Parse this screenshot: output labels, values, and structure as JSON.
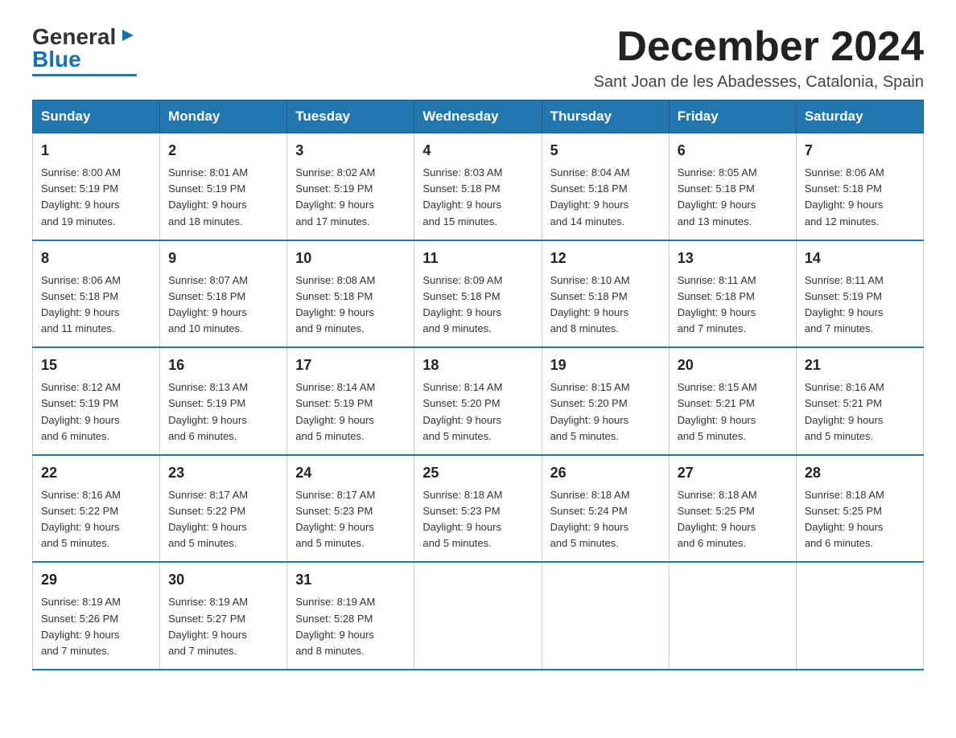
{
  "header": {
    "logo_general": "General",
    "logo_blue": "Blue",
    "month_title": "December 2024",
    "subtitle": "Sant Joan de les Abadesses, Catalonia, Spain"
  },
  "weekdays": [
    "Sunday",
    "Monday",
    "Tuesday",
    "Wednesday",
    "Thursday",
    "Friday",
    "Saturday"
  ],
  "weeks": [
    [
      {
        "day": "1",
        "info": "Sunrise: 8:00 AM\nSunset: 5:19 PM\nDaylight: 9 hours\nand 19 minutes."
      },
      {
        "day": "2",
        "info": "Sunrise: 8:01 AM\nSunset: 5:19 PM\nDaylight: 9 hours\nand 18 minutes."
      },
      {
        "day": "3",
        "info": "Sunrise: 8:02 AM\nSunset: 5:19 PM\nDaylight: 9 hours\nand 17 minutes."
      },
      {
        "day": "4",
        "info": "Sunrise: 8:03 AM\nSunset: 5:18 PM\nDaylight: 9 hours\nand 15 minutes."
      },
      {
        "day": "5",
        "info": "Sunrise: 8:04 AM\nSunset: 5:18 PM\nDaylight: 9 hours\nand 14 minutes."
      },
      {
        "day": "6",
        "info": "Sunrise: 8:05 AM\nSunset: 5:18 PM\nDaylight: 9 hours\nand 13 minutes."
      },
      {
        "day": "7",
        "info": "Sunrise: 8:06 AM\nSunset: 5:18 PM\nDaylight: 9 hours\nand 12 minutes."
      }
    ],
    [
      {
        "day": "8",
        "info": "Sunrise: 8:06 AM\nSunset: 5:18 PM\nDaylight: 9 hours\nand 11 minutes."
      },
      {
        "day": "9",
        "info": "Sunrise: 8:07 AM\nSunset: 5:18 PM\nDaylight: 9 hours\nand 10 minutes."
      },
      {
        "day": "10",
        "info": "Sunrise: 8:08 AM\nSunset: 5:18 PM\nDaylight: 9 hours\nand 9 minutes."
      },
      {
        "day": "11",
        "info": "Sunrise: 8:09 AM\nSunset: 5:18 PM\nDaylight: 9 hours\nand 9 minutes."
      },
      {
        "day": "12",
        "info": "Sunrise: 8:10 AM\nSunset: 5:18 PM\nDaylight: 9 hours\nand 8 minutes."
      },
      {
        "day": "13",
        "info": "Sunrise: 8:11 AM\nSunset: 5:18 PM\nDaylight: 9 hours\nand 7 minutes."
      },
      {
        "day": "14",
        "info": "Sunrise: 8:11 AM\nSunset: 5:19 PM\nDaylight: 9 hours\nand 7 minutes."
      }
    ],
    [
      {
        "day": "15",
        "info": "Sunrise: 8:12 AM\nSunset: 5:19 PM\nDaylight: 9 hours\nand 6 minutes."
      },
      {
        "day": "16",
        "info": "Sunrise: 8:13 AM\nSunset: 5:19 PM\nDaylight: 9 hours\nand 6 minutes."
      },
      {
        "day": "17",
        "info": "Sunrise: 8:14 AM\nSunset: 5:19 PM\nDaylight: 9 hours\nand 5 minutes."
      },
      {
        "day": "18",
        "info": "Sunrise: 8:14 AM\nSunset: 5:20 PM\nDaylight: 9 hours\nand 5 minutes."
      },
      {
        "day": "19",
        "info": "Sunrise: 8:15 AM\nSunset: 5:20 PM\nDaylight: 9 hours\nand 5 minutes."
      },
      {
        "day": "20",
        "info": "Sunrise: 8:15 AM\nSunset: 5:21 PM\nDaylight: 9 hours\nand 5 minutes."
      },
      {
        "day": "21",
        "info": "Sunrise: 8:16 AM\nSunset: 5:21 PM\nDaylight: 9 hours\nand 5 minutes."
      }
    ],
    [
      {
        "day": "22",
        "info": "Sunrise: 8:16 AM\nSunset: 5:22 PM\nDaylight: 9 hours\nand 5 minutes."
      },
      {
        "day": "23",
        "info": "Sunrise: 8:17 AM\nSunset: 5:22 PM\nDaylight: 9 hours\nand 5 minutes."
      },
      {
        "day": "24",
        "info": "Sunrise: 8:17 AM\nSunset: 5:23 PM\nDaylight: 9 hours\nand 5 minutes."
      },
      {
        "day": "25",
        "info": "Sunrise: 8:18 AM\nSunset: 5:23 PM\nDaylight: 9 hours\nand 5 minutes."
      },
      {
        "day": "26",
        "info": "Sunrise: 8:18 AM\nSunset: 5:24 PM\nDaylight: 9 hours\nand 5 minutes."
      },
      {
        "day": "27",
        "info": "Sunrise: 8:18 AM\nSunset: 5:25 PM\nDaylight: 9 hours\nand 6 minutes."
      },
      {
        "day": "28",
        "info": "Sunrise: 8:18 AM\nSunset: 5:25 PM\nDaylight: 9 hours\nand 6 minutes."
      }
    ],
    [
      {
        "day": "29",
        "info": "Sunrise: 8:19 AM\nSunset: 5:26 PM\nDaylight: 9 hours\nand 7 minutes."
      },
      {
        "day": "30",
        "info": "Sunrise: 8:19 AM\nSunset: 5:27 PM\nDaylight: 9 hours\nand 7 minutes."
      },
      {
        "day": "31",
        "info": "Sunrise: 8:19 AM\nSunset: 5:28 PM\nDaylight: 9 hours\nand 8 minutes."
      },
      {
        "day": "",
        "info": ""
      },
      {
        "day": "",
        "info": ""
      },
      {
        "day": "",
        "info": ""
      },
      {
        "day": "",
        "info": ""
      }
    ]
  ]
}
